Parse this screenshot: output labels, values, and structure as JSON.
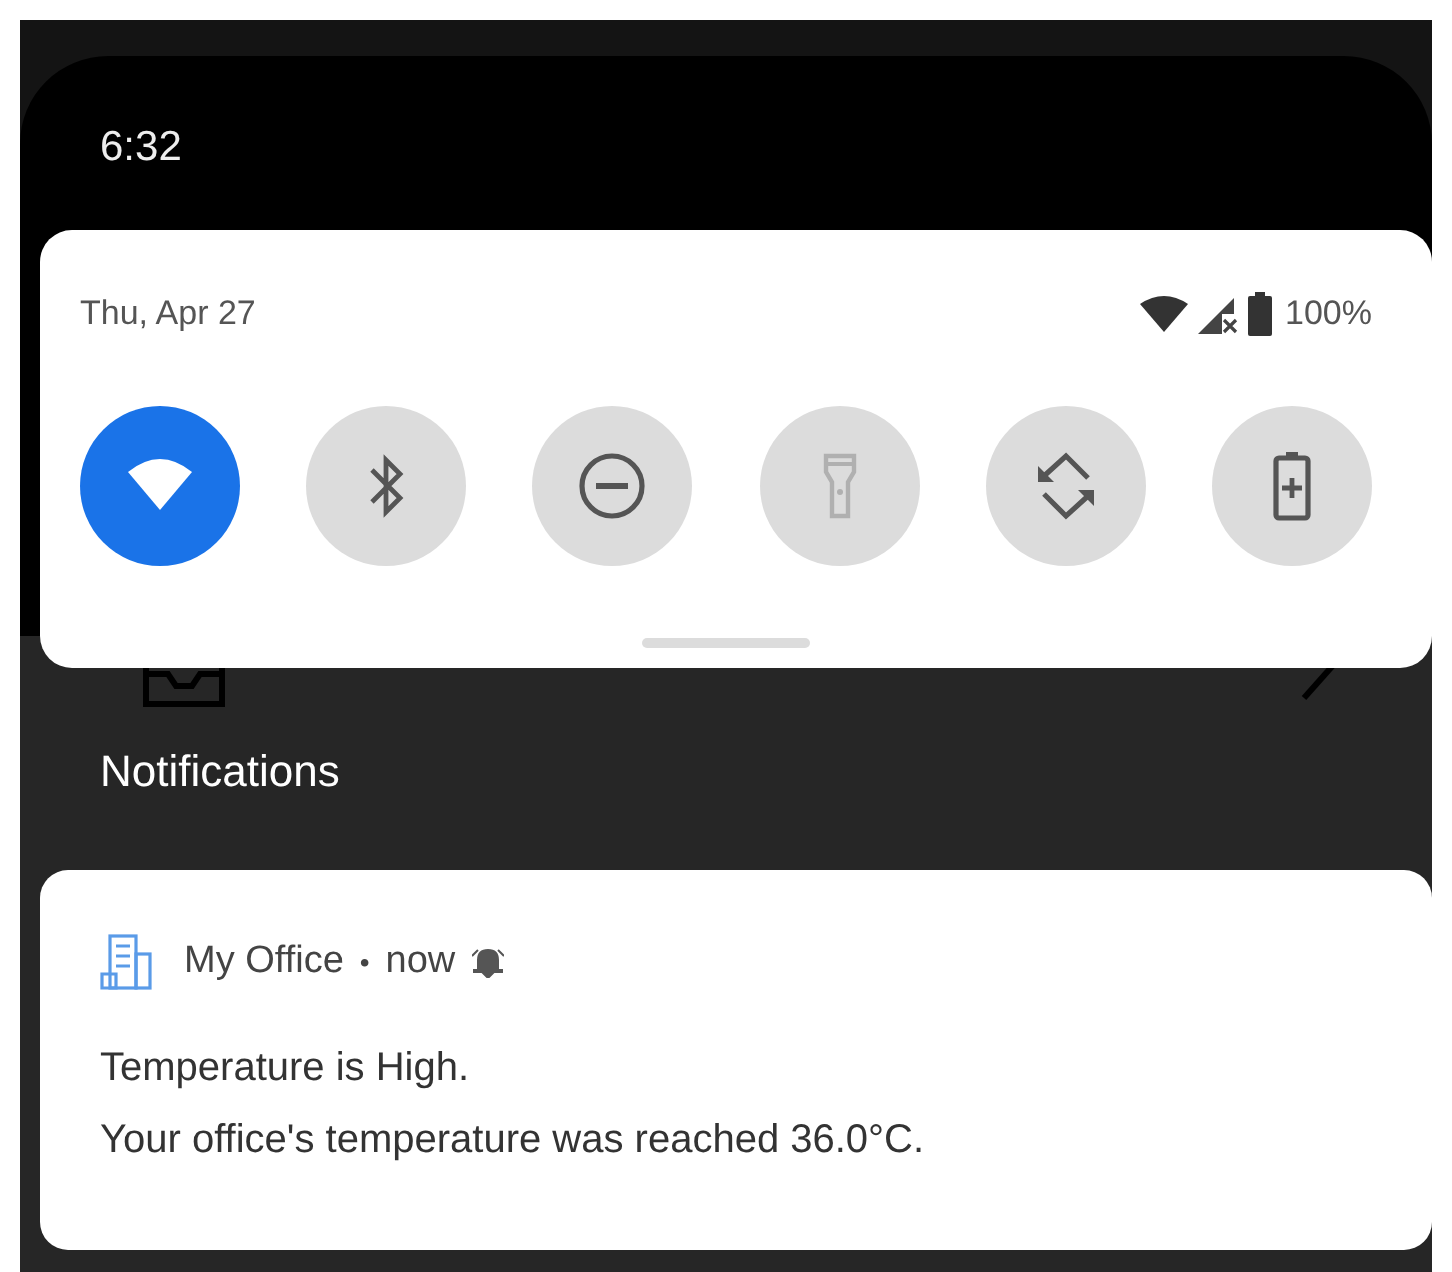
{
  "status_bar": {
    "time": "6:32"
  },
  "quick_settings": {
    "date": "Thu, Apr 27",
    "battery": "100%",
    "tiles": [
      {
        "kind": "wifi",
        "on": true,
        "disabled": false
      },
      {
        "kind": "bluetooth",
        "on": false,
        "disabled": false
      },
      {
        "kind": "dnd",
        "on": false,
        "disabled": false
      },
      {
        "kind": "flashlight",
        "on": false,
        "disabled": true
      },
      {
        "kind": "rotate",
        "on": false,
        "disabled": false
      },
      {
        "kind": "battery_saver",
        "on": false,
        "disabled": false
      }
    ]
  },
  "notifications": {
    "header": "Notifications",
    "items": [
      {
        "app": "My Office",
        "separator": "•",
        "time": "now",
        "title": "Temperature is High.",
        "text": "Your office's temperature was reached 36.0°C."
      }
    ]
  }
}
